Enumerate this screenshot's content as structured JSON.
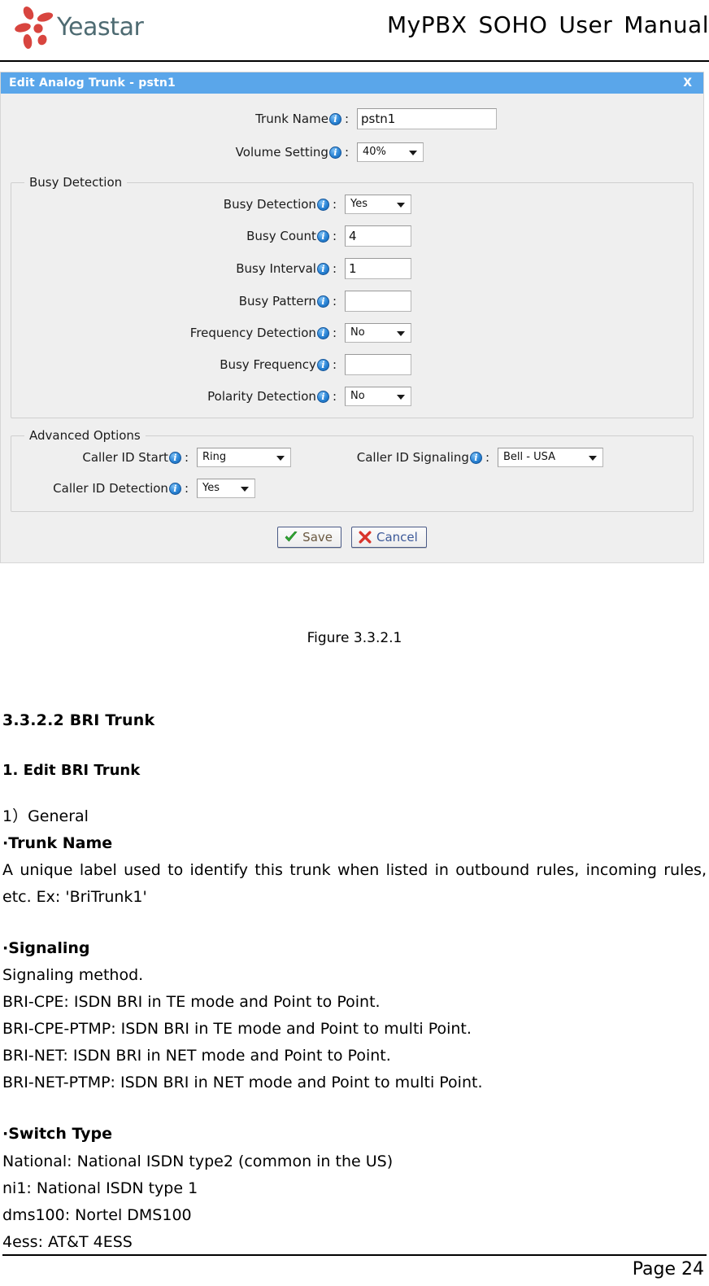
{
  "header": {
    "logo_text": "Yeastar",
    "logo_icon": "yeastar-flower-logo",
    "manual_title_words": [
      "MyPBX",
      "SOHO",
      "User",
      "Manual"
    ],
    "manual_title": "MyPBX SOHO User Manual"
  },
  "dialog": {
    "title": "Edit Analog Trunk - pstn1",
    "close_label": "X",
    "info_icon": "info-icon",
    "general": {
      "trunk_name": {
        "label": "Trunk Name",
        "colon": ":",
        "value": "pstn1"
      },
      "volume_setting": {
        "label": "Volume Setting",
        "colon": ":",
        "value": "40%"
      }
    },
    "busy_detection_group": {
      "legend": "Busy Detection",
      "fields": [
        {
          "label": "Busy Detection",
          "colon": ":",
          "type": "select",
          "value": "Yes"
        },
        {
          "label": "Busy Count",
          "colon": ":",
          "type": "text",
          "value": "4"
        },
        {
          "label": "Busy Interval",
          "colon": ":",
          "type": "text",
          "value": "1"
        },
        {
          "label": "Busy Pattern",
          "colon": ":",
          "type": "text",
          "value": ""
        },
        {
          "label": "Frequency Detection",
          "colon": ":",
          "type": "select",
          "value": "No"
        },
        {
          "label": "Busy Frequency",
          "colon": ":",
          "type": "text",
          "value": ""
        },
        {
          "label": "Polarity Detection",
          "colon": ":",
          "type": "select",
          "value": "No"
        }
      ]
    },
    "advanced_options_group": {
      "legend": "Advanced Options",
      "caller_id_start": {
        "label": "Caller ID Start",
        "colon": ":",
        "value": "Ring"
      },
      "caller_id_signaling": {
        "label": "Caller ID Signaling",
        "colon": ":",
        "value": "Bell - USA"
      },
      "caller_id_detection": {
        "label": "Caller ID Detection",
        "colon": ":",
        "value": "Yes"
      }
    },
    "buttons": {
      "save": "Save",
      "cancel": "Cancel"
    }
  },
  "figure_caption": "Figure 3.3.2.1",
  "content": {
    "section_heading": "3.3.2.2 BRI Trunk",
    "sub_heading": "1. Edit BRI Trunk",
    "general_label": "1）General",
    "trunk_name_heading": "·Trunk Name",
    "trunk_name_desc": "A unique label used to identify this trunk when listed in outbound rules, incoming rules, etc. Ex: 'BriTrunk1'",
    "signaling_heading": "·Signaling",
    "signaling_lines": [
      "Signaling method.",
      "BRI-CPE: ISDN BRI in TE mode and Point to Point.",
      "BRI-CPE-PTMP: ISDN BRI in TE mode and Point to multi Point.",
      "BRI-NET: ISDN BRI in NET mode and Point to Point.",
      "BRI-NET-PTMP: ISDN BRI in NET mode and Point to multi Point."
    ],
    "switch_type_heading": "·Switch Type",
    "switch_type_lines": [
      "National: National ISDN type2 (common in the US)",
      "ni1: National ISDN type 1",
      "dms100: Nortel DMS100",
      "4ess: AT&T 4ESS"
    ]
  },
  "footer": {
    "page_number": "Page 24"
  },
  "colors": {
    "titlebar_blue": "#5aa6ea",
    "dialog_bg": "#efefef",
    "logo_red": "#d8453f",
    "logo_text": "#4e6b72",
    "link_blue": "#3d5a9a",
    "check_green": "#2fa832",
    "x_red": "#d9342b"
  }
}
